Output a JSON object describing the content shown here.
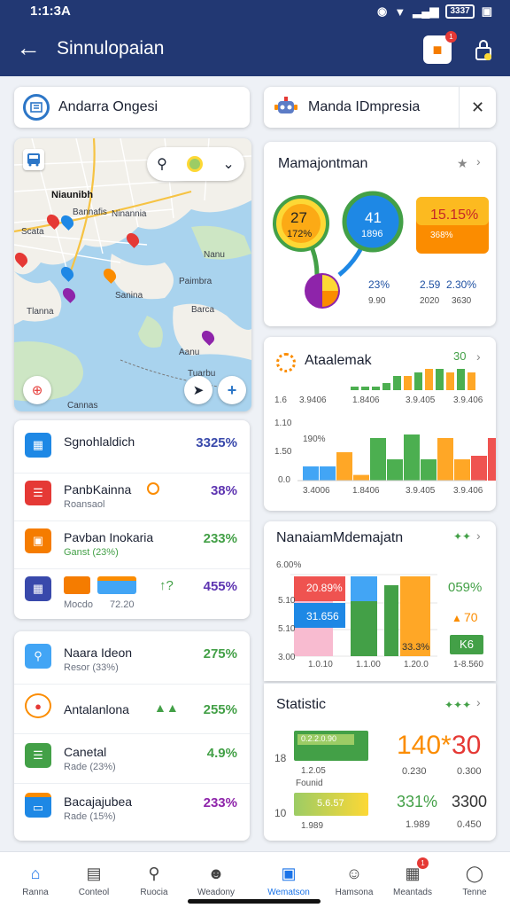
{
  "status_bar": {
    "time": "1:1:3A",
    "battery": "3337"
  },
  "app_bar": {
    "title": "Sinnulopaian",
    "notif_badge": "1"
  },
  "search_left": {
    "label": "Andarra Ongesi"
  },
  "search_right": {
    "label": "Manda IDmpresia"
  },
  "map": {
    "labels": [
      "Niaunibh",
      "Bannafis",
      "Ninannia",
      "Scata",
      "Nanu",
      "Paimbra",
      "Sanina",
      "Tlanna",
      "Barca",
      "Cannas",
      "Aanu",
      "Tuarbu"
    ],
    "pin_colors": [
      "#e53935",
      "#1e88e5",
      "#fb8c00",
      "#43a047",
      "#8e24aa",
      "#e53935",
      "#1e88e5",
      "#fb8c00"
    ]
  },
  "list1": [
    {
      "label": "Sgnohlaldich",
      "sub": "",
      "value": "3325%",
      "value_color": "#3949ab",
      "icon": "calendar-icon",
      "color": "#1e88e5"
    },
    {
      "label": "PanbKainna",
      "sub": "Roansaol",
      "value": "38%",
      "value_color": "#5e35b1",
      "icon": "document-icon",
      "color": "#e53935"
    },
    {
      "label": "Pavban Inokaria",
      "sub": "Ganst (23%)",
      "value": "233%",
      "value_color": "#43a047",
      "icon": "store-icon",
      "color": "#f57c00"
    },
    {
      "label": "Mocdo",
      "sub": "",
      "value": "455%",
      "value_color": "#5e35b1",
      "icon": "shop-icon",
      "color": "#3949ab",
      "extra": "72.20"
    }
  ],
  "list2": [
    {
      "label": "Naara Ideon",
      "sub": "Resor (33%)",
      "value": "275%",
      "value_color": "#43a047",
      "icon": "location-icon",
      "color": "#42a5f5"
    },
    {
      "label": "Antalanlona",
      "sub": "",
      "value": "255%",
      "value_color": "#43a047",
      "icon": "target-icon",
      "color": "#e53935"
    },
    {
      "label": "Canetal",
      "sub": "Rade (23%)",
      "value": "4.9%",
      "value_color": "#43a047",
      "icon": "list-icon",
      "color": "#43a047"
    },
    {
      "label": "Bacajajubea",
      "sub": "Rade (15%)",
      "value": "233%",
      "value_color": "#8e24aa",
      "icon": "wallet-icon",
      "color": "#1e88e5"
    }
  ],
  "gauges": {
    "title": "Mamajontman",
    "items": [
      {
        "top": "27",
        "bottom": "172%",
        "color": "#f9a825"
      },
      {
        "top": "41",
        "bottom": "1896",
        "color": "#1e88e5"
      },
      {
        "top": "15.15%",
        "bottom": "368%",
        "color": "#fb8c00"
      }
    ],
    "pie_label": "",
    "readouts": [
      {
        "a": "23%",
        "b": "9.90"
      },
      {
        "a": "2.59",
        "b": "2.30%"
      },
      {
        "a": "2020",
        "b": "3630"
      }
    ]
  },
  "chart1": {
    "title": "Ataalemak",
    "top_label": "30",
    "left_ticks": [
      "1.6",
      "1.10",
      "1.50",
      "0.0"
    ],
    "inline_label": "190%",
    "cats": [
      "3.9406",
      "1.8406",
      "3.9.405",
      "3.9.406"
    ],
    "cats2": [
      "3.4006",
      "1.8406",
      "3.9.405",
      "3.9.406"
    ]
  },
  "chart_data": [
    {
      "type": "bar",
      "title": "Ataalemak",
      "categories": [
        "3.9406",
        "1.8406",
        "3.9.405",
        "3.9.406"
      ],
      "series": [
        {
          "values": [
            2,
            2,
            2,
            2,
            3,
            4,
            4,
            5,
            6,
            5,
            4,
            3,
            5,
            4,
            6,
            4,
            5,
            4,
            5
          ]
        }
      ],
      "ylim": [
        0,
        10
      ],
      "colors": [
        "#4caf50",
        "#ffa726",
        "#ef5350",
        "#42a5f5"
      ]
    },
    {
      "type": "bar",
      "title": "NanaiamMdemajatn",
      "categories": [
        "1.0.10",
        "1.1.00",
        "1.20.0"
      ],
      "series": [
        {
          "values": [
            20,
            31,
            0
          ]
        },
        {
          "values": [
            0,
            0,
            0
          ]
        }
      ],
      "ylim": [
        0,
        100
      ],
      "colors": [
        "#ef5350",
        "#42a5f5",
        "#4caf50",
        "#ffa726"
      ]
    }
  ],
  "chart2": {
    "title": "NanaiamMdemajatn",
    "left_ticks": [
      "6.00%",
      "5.10",
      "5.10",
      "3.00"
    ],
    "labels_in_bars": [
      "20.89%",
      "31.656",
      "33.3%"
    ],
    "right_values": [
      {
        "text": "059%",
        "color": "#43a047"
      },
      {
        "text": "70",
        "color": "#fb8c00"
      },
      {
        "text": "K6",
        "color": "#43a047"
      },
      {
        "text": "1-8.560",
        "color": "#555"
      }
    ],
    "cats": [
      "1.0.10",
      "1.1.00",
      "1.20.0"
    ]
  },
  "stats": {
    "title": "Statistic",
    "left_ticks": [
      "18",
      "10"
    ],
    "bar1_label": "0.2.2.0.90",
    "bar2_label": "5.6.57",
    "big_values": [
      {
        "text": "140*",
        "color": "#fb8c00"
      },
      {
        "text": "30",
        "color": "#e53935"
      },
      {
        "text": "331%",
        "color": "#43a047"
      },
      {
        "text": "3300",
        "color": "#333"
      }
    ],
    "small_values": [
      "1.2.05",
      "Founid",
      "0.230",
      "0.300",
      "1.989",
      "0.450"
    ]
  },
  "nav": [
    {
      "label": "Ranna",
      "icon": "home-icon",
      "active": false,
      "home": true
    },
    {
      "label": "Conteol",
      "icon": "document-icon",
      "active": false
    },
    {
      "label": "Ruocia",
      "icon": "search-icon",
      "active": false
    },
    {
      "label": "Weadony",
      "icon": "person-icon",
      "active": false
    },
    {
      "label": "Wematson",
      "icon": "tablet-icon",
      "active": true
    },
    {
      "label": "Hamsona",
      "icon": "chat-icon",
      "active": false
    },
    {
      "label": "Meantads",
      "icon": "calendar-icon",
      "active": false,
      "badge": "1"
    },
    {
      "label": "Tenne",
      "icon": "account-icon",
      "active": false
    }
  ]
}
